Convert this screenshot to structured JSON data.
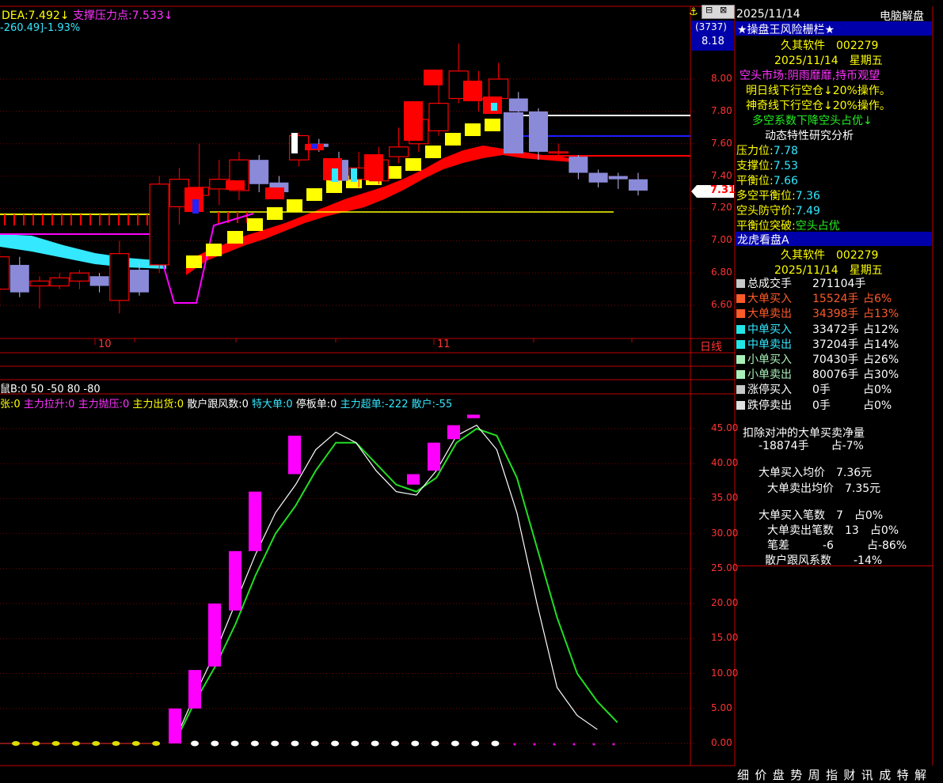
{
  "top_legend": {
    "dea": "DEA:7.492",
    "dea_arrow": "↓",
    "support_label": "支撑压力点:7.533",
    "support_arrow": "↓",
    "change": "-260.49]-1.93%"
  },
  "price_axis": {
    "ticks": [
      "8.00",
      "7.80",
      "7.60",
      "7.40",
      "7.20",
      "7.00",
      "6.80",
      "6.60"
    ],
    "current_price": "7.31",
    "box_code": "(3737)",
    "box_high": "8.18"
  },
  "x_axis": {
    "labels": [
      "10",
      "11"
    ],
    "period": "日线"
  },
  "sub_header": {
    "row1": "鼠B:0 50 -50 80 -80",
    "row2_items": [
      "张:0",
      "主力拉升:0",
      "主力抛压:0",
      "主力出货:0",
      "散户跟风数:0",
      "特大单:0",
      "停板单:0",
      "主力超单:-222",
      "散户:-55"
    ]
  },
  "indicator_axis": {
    "ticks": [
      "45.00",
      "40.00",
      "35.00",
      "30.00",
      "25.00",
      "20.00",
      "15.00",
      "10.00",
      "5.00",
      "0.00"
    ]
  },
  "right_panel": {
    "date": "2025/11/14",
    "title_right": "电脑解盘",
    "section1_title": "★操盘王风险栅栏★",
    "company": "久其软件",
    "code": "002279",
    "date2": "2025/11/14",
    "weekday": "星期五",
    "market": "空头市场:阴雨靡靡,持币观望",
    "line1": "明日线下行空仓↓20%操作。",
    "line2": "神奇线下行空仓↓20%操作。",
    "line3": "多空系数下降空头占优↓",
    "line4": "动态特性研究分析",
    "pressure_label": "压力位:",
    "pressure_val": "7.78",
    "support_label": "支撑位:",
    "support_val": "7.53",
    "balance_label": "平衡位:",
    "balance_val": "7.66",
    "ls_balance_label": "多空平衡位:",
    "ls_balance_val": "7.36",
    "defense_label": "空头防守价:",
    "defense_val": "7.49",
    "break_label": "平衡位突破:",
    "break_val": "空头占优",
    "section2_title": "龙虎看盘A",
    "company2": "久其软件",
    "code2": "002279",
    "date3": "2025/11/14",
    "weekday2": "星期五",
    "volume_rows": [
      {
        "label": "总成交手",
        "value": "271104手",
        "pct": "",
        "color": "#c8c8c8"
      },
      {
        "label": "大单买入",
        "value": "15524手",
        "pct": "占6%",
        "color": "#ff5a2a"
      },
      {
        "label": "大单卖出",
        "value": "34398手",
        "pct": "占13%",
        "color": "#ff5a2a"
      },
      {
        "label": "中单买入",
        "value": "33472手",
        "pct": "占12%",
        "color": "#22e6e6"
      },
      {
        "label": "中单卖出",
        "value": "37204手",
        "pct": "占14%",
        "color": "#22e6e6"
      },
      {
        "label": "小单买入",
        "value": "70430手",
        "pct": "占26%",
        "color": "#a8f0b8"
      },
      {
        "label": "小单卖出",
        "value": "80076手",
        "pct": "占30%",
        "color": "#a8f0b8"
      },
      {
        "label": "涨停买入",
        "value": "0手",
        "pct": "占0%",
        "color": "#c8c8c8"
      },
      {
        "label": "跌停卖出",
        "value": "0手",
        "pct": "占0%",
        "color": "#e0e0e0"
      }
    ],
    "net_title": "扣除对冲的大单买卖净量",
    "net_value": "-18874手",
    "net_pct": "占-7%",
    "avg_buy_label": "大单买入均价",
    "avg_buy_val": "7.36元",
    "avg_sell_label": "大单卖出均价",
    "avg_sell_val": "7.35元",
    "cnt_buy_label": "大单买入笔数",
    "cnt_buy_val": "7",
    "cnt_buy_pct": "占0%",
    "cnt_sell_label": "大单卖出笔数",
    "cnt_sell_val": "13",
    "cnt_sell_pct": "占0%",
    "diff_label": "笔差",
    "diff_val": "-6",
    "diff_pct": "占-86%",
    "follow_label": "散户跟风系数",
    "follow_val": "-14%"
  },
  "bottom_tabs": [
    "细",
    "价",
    "盘",
    "势",
    "周",
    "指",
    "财",
    "讯",
    "成",
    "特",
    "解"
  ],
  "colors": {
    "up": "#ff0000",
    "down": "#8a8ad8",
    "ribbon": "#ff0000",
    "accent_cyan": "#00ffff",
    "gold": "#ffff00",
    "magenta": "#ff00ff"
  },
  "chart_data": {
    "type": "candlestick",
    "xlabel": "",
    "ylabel": "",
    "ylim": [
      6.45,
      8.25
    ],
    "x_labels": [
      "10",
      "11"
    ],
    "candles_approx": [
      {
        "o": 6.7,
        "c": 6.9,
        "h": 6.95,
        "l": 6.6
      },
      {
        "o": 6.85,
        "c": 6.68,
        "h": 6.9,
        "l": 6.65
      },
      {
        "o": 6.72,
        "c": 6.75,
        "h": 6.78,
        "l": 6.58
      },
      {
        "o": 6.72,
        "c": 6.77,
        "h": 6.8,
        "l": 6.7
      },
      {
        "o": 6.75,
        "c": 6.8,
        "h": 6.82,
        "l": 6.7
      },
      {
        "o": 6.78,
        "c": 6.72,
        "h": 6.8,
        "l": 6.68
      },
      {
        "o": 6.63,
        "c": 6.92,
        "h": 7.0,
        "l": 6.55
      },
      {
        "o": 6.82,
        "c": 6.68,
        "h": 6.86,
        "l": 6.66
      },
      {
        "o": 6.85,
        "c": 7.35,
        "h": 7.4,
        "l": 6.8
      },
      {
        "o": 7.21,
        "c": 7.38,
        "h": 7.45,
        "l": 7.1
      },
      {
        "o": 7.28,
        "c": 7.33,
        "h": 7.6,
        "l": 7.2
      },
      {
        "o": 7.32,
        "c": 7.38,
        "h": 7.5,
        "l": 7.22
      },
      {
        "o": 7.31,
        "c": 7.5,
        "h": 7.55,
        "l": 7.25
      },
      {
        "o": 7.5,
        "c": 7.35,
        "h": 7.53,
        "l": 7.3
      },
      {
        "o": 7.36,
        "c": 7.3,
        "h": 7.4,
        "l": 7.28
      },
      {
        "o": 7.5,
        "c": 7.65,
        "h": 7.67,
        "l": 7.46
      },
      {
        "o": 7.6,
        "c": 7.58,
        "h": 7.63,
        "l": 7.55
      },
      {
        "o": 7.5,
        "c": 7.37,
        "h": 7.55,
        "l": 7.35
      },
      {
        "o": 7.38,
        "c": 7.45,
        "h": 7.55,
        "l": 7.33
      },
      {
        "o": 7.37,
        "c": 7.5,
        "h": 7.58,
        "l": 7.35
      },
      {
        "o": 7.52,
        "c": 7.58,
        "h": 7.7,
        "l": 7.48
      },
      {
        "o": 7.6,
        "c": 7.75,
        "h": 7.85,
        "l": 7.55
      },
      {
        "o": 7.68,
        "c": 7.85,
        "h": 8.0,
        "l": 7.65
      },
      {
        "o": 7.88,
        "c": 8.05,
        "h": 8.22,
        "l": 7.85
      },
      {
        "o": 7.88,
        "c": 7.88,
        "h": 8.05,
        "l": 7.8
      },
      {
        "o": 7.88,
        "c": 8.0,
        "h": 8.1,
        "l": 7.85
      },
      {
        "o": 7.88,
        "c": 7.8,
        "h": 7.92,
        "l": 7.75
      },
      {
        "o": 7.8,
        "c": 7.55,
        "h": 7.82,
        "l": 7.5
      },
      {
        "o": 7.55,
        "c": 7.55,
        "h": 7.6,
        "l": 7.5
      },
      {
        "o": 7.52,
        "c": 7.42,
        "h": 7.53,
        "l": 7.38
      },
      {
        "o": 7.42,
        "c": 7.36,
        "h": 7.44,
        "l": 7.33
      },
      {
        "o": 7.4,
        "c": 7.38,
        "h": 7.42,
        "l": 7.32
      },
      {
        "o": 7.38,
        "c": 7.31,
        "h": 7.42,
        "l": 7.28
      }
    ]
  }
}
